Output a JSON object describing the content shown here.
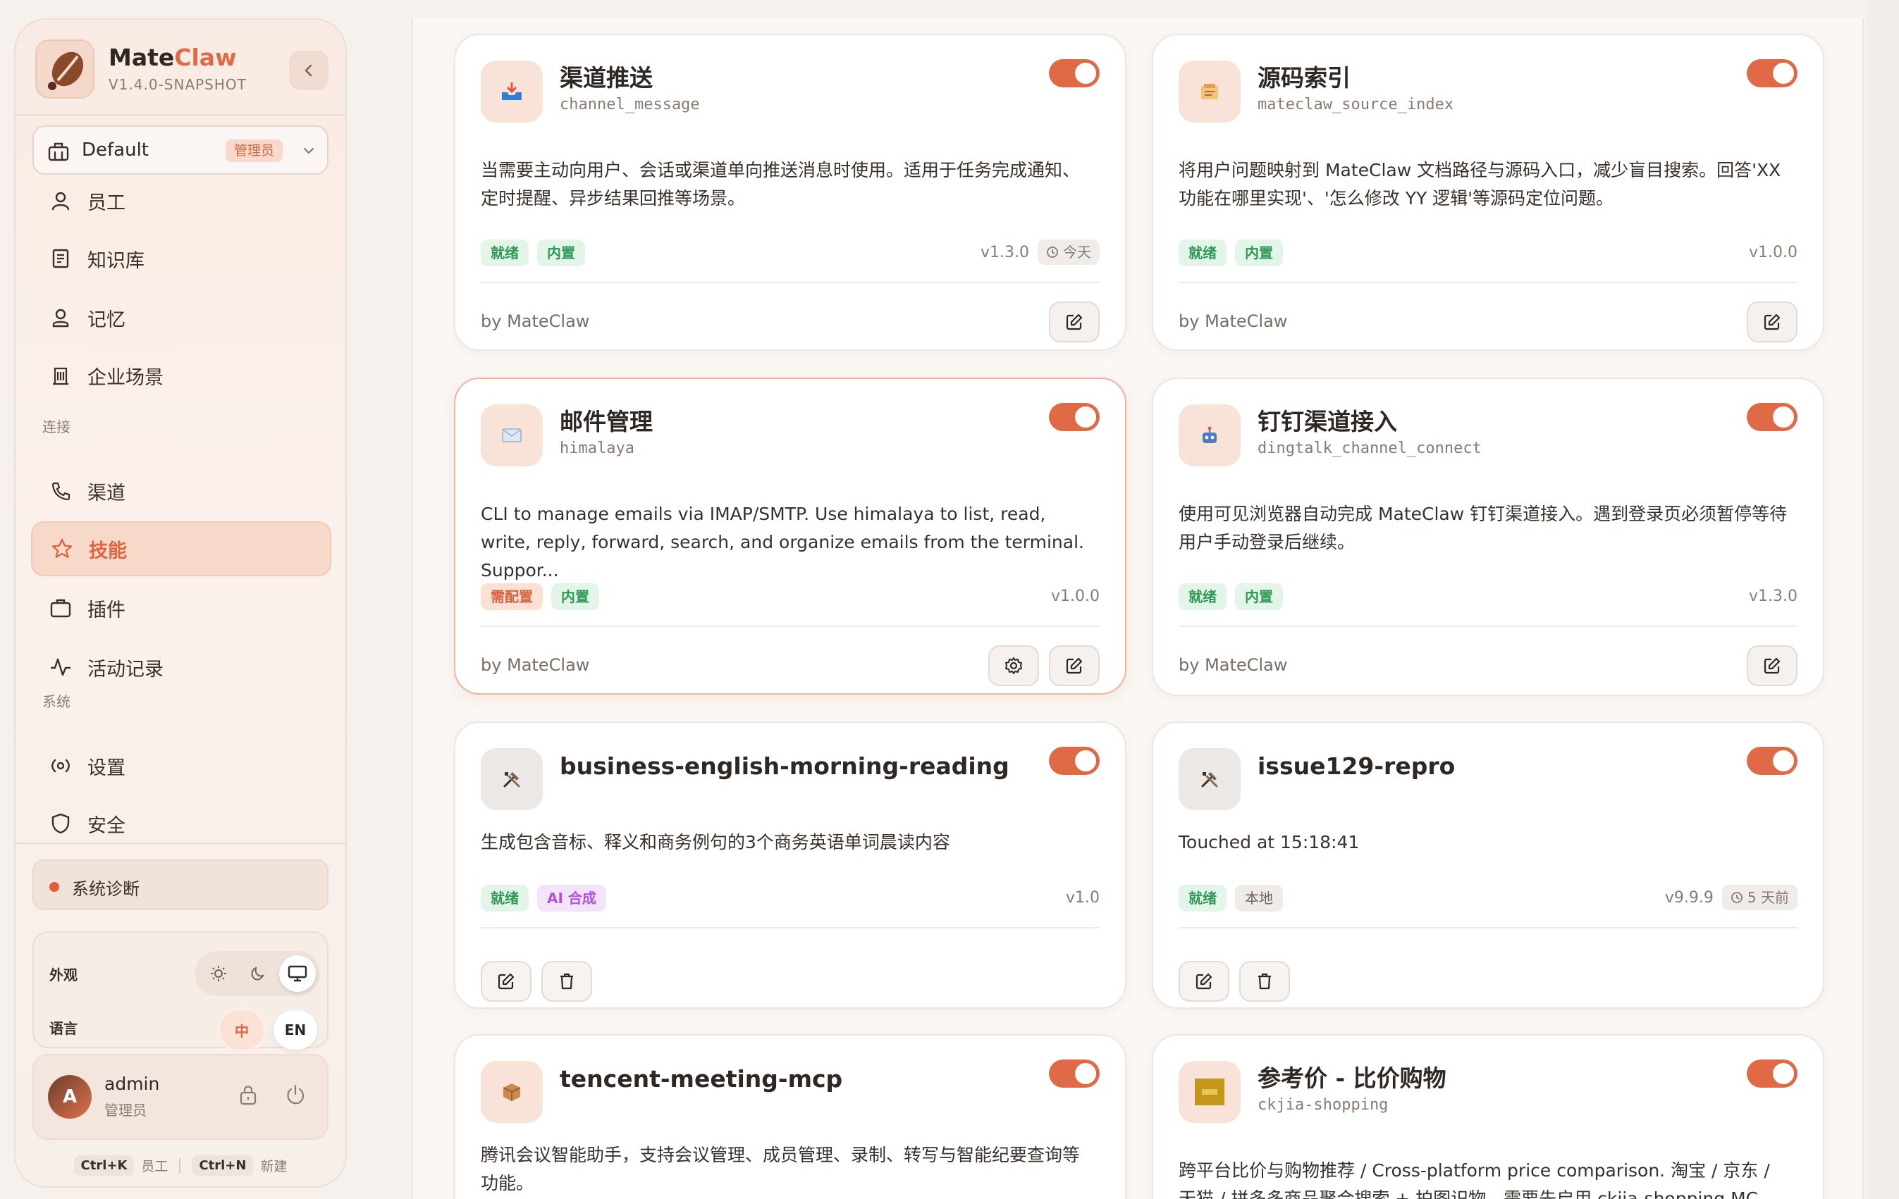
{
  "brand": {
    "name_a": "Mate",
    "name_b": "Claw",
    "version": "V1.4.0-SNAPSHOT"
  },
  "workspace": {
    "name": "Default",
    "role": "管理员"
  },
  "nav": {
    "items": [
      {
        "label": "员工",
        "icon": "user-icon"
      },
      {
        "label": "知识库",
        "icon": "book-icon"
      },
      {
        "label": "记忆",
        "icon": "memory-icon"
      },
      {
        "label": "企业场景",
        "icon": "building-icon"
      }
    ],
    "section_connect": "连接",
    "connect_items": [
      {
        "label": "渠道",
        "icon": "phone-icon"
      },
      {
        "label": "技能",
        "icon": "star-icon",
        "active": true
      },
      {
        "label": "插件",
        "icon": "briefcase-icon"
      },
      {
        "label": "活动记录",
        "icon": "activity-icon"
      }
    ],
    "section_system": "系统",
    "system_items": [
      {
        "label": "设置",
        "icon": "radio-icon"
      },
      {
        "label": "安全",
        "icon": "shield-icon"
      }
    ]
  },
  "diagnostics": {
    "label": "系统诊断"
  },
  "prefs": {
    "appearance_label": "外观",
    "language_label": "语言",
    "lang_zh": "中",
    "lang_en": "EN",
    "selected_theme": "system"
  },
  "user": {
    "initial": "A",
    "name": "admin",
    "role": "管理员"
  },
  "shortcuts": {
    "k_key": "Ctrl+K",
    "k_label": "员工",
    "n_key": "Ctrl+N",
    "n_label": "新建"
  },
  "colors": {
    "accent": "#e06a45",
    "ready": "#2e9a56",
    "needs_config": "#d6623f",
    "ai": "#b152e0"
  },
  "cards": [
    {
      "title": "渠道推送",
      "slug": "channel_message",
      "desc": "当需要主动向用户、会话或渠道单向推送消息时使用。适用于任务完成通知、定时提醒、异步结果回推等场景。",
      "tags": [
        "就绪",
        "内置"
      ],
      "version": "v1.3.0",
      "time": "今天",
      "author": "by MateClaw",
      "enabled": true
    },
    {
      "title": "源码索引",
      "slug": "mateclaw_source_index",
      "desc": "将用户问题映射到 MateClaw 文档路径与源码入口，减少盲目搜索。回答'XX 功能在哪里实现'、'怎么修改 YY 逻辑'等源码定位问题。",
      "tags": [
        "就绪",
        "内置"
      ],
      "version": "v1.0.0",
      "author": "by MateClaw",
      "enabled": true
    },
    {
      "title": "邮件管理",
      "slug": "himalaya",
      "desc": "CLI to manage emails via IMAP/SMTP. Use himalaya to list, read, write, reply, forward, search, and organize emails from the terminal. Suppor...",
      "tags": [
        "需配置",
        "内置"
      ],
      "version": "v1.0.0",
      "author": "by MateClaw",
      "enabled": true
    },
    {
      "title": "钉钉渠道接入",
      "slug": "dingtalk_channel_connect",
      "desc": "使用可见浏览器自动完成 MateClaw 钉钉渠道接入。遇到登录页必须暂停等待用户手动登录后继续。",
      "tags": [
        "就绪",
        "内置"
      ],
      "version": "v1.3.0",
      "author": "by MateClaw",
      "enabled": true
    },
    {
      "title": "business-english-morning-reading",
      "desc": "生成包含音标、释义和商务例句的3个商务英语单词晨读内容",
      "tags": [
        "就绪",
        "AI 合成"
      ],
      "version": "v1.0",
      "enabled": true
    },
    {
      "title": "issue129-repro",
      "desc": "Touched at 15:18:41",
      "tags": [
        "就绪",
        "本地"
      ],
      "version": "v9.9.9",
      "time": "5 天前",
      "enabled": true
    },
    {
      "title": "tencent-meeting-mcp",
      "desc": "腾讯会议智能助手，支持会议管理、成员管理、录制、转写与智能纪要查询等功能。",
      "enabled": true
    },
    {
      "title": "参考价 - 比价购物",
      "slug": "ckjia-shopping",
      "desc": "跨平台比价与购物推荐 / Cross-platform price comparison. 淘宝 / 京东 / 天猫 / 拼多多商品聚合搜索 + 拍图识物。需要先启用 ckjia-shopping MC...",
      "enabled": true
    }
  ]
}
